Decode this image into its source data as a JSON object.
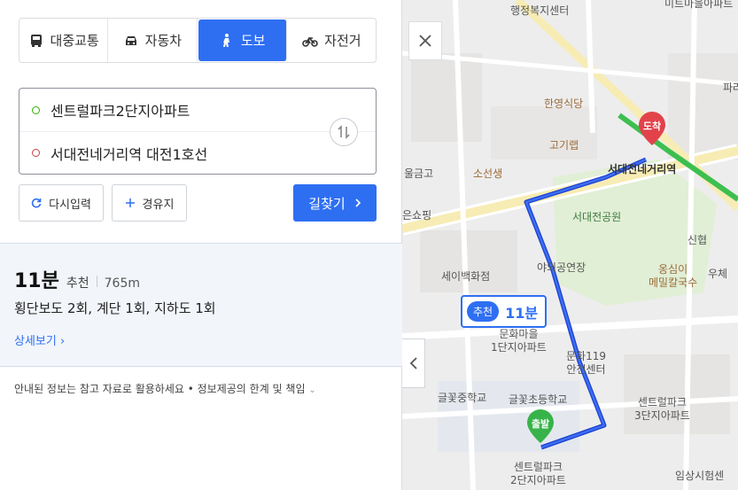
{
  "modes": [
    {
      "label": "대중교통",
      "icon": "bus-icon"
    },
    {
      "label": "자동차",
      "icon": "car-icon"
    },
    {
      "label": "도보",
      "icon": "walk-icon",
      "active": true
    },
    {
      "label": "자전거",
      "icon": "bicycle-icon"
    }
  ],
  "route": {
    "start": "센트럴파크2단지아파트",
    "end": "서대전네거리역 대전1호선"
  },
  "buttons": {
    "reset": "다시입력",
    "waypoint": "경유지",
    "search": "길찾기"
  },
  "result": {
    "time": "11분",
    "tag": "추천",
    "distance": "765m",
    "detail": "횡단보도 2회, 계단 1회, 지하도 1회",
    "more": "상세보기"
  },
  "notice": {
    "text": "안내된 정보는 참고 자료로 활용하세요",
    "link": "정보제공의 한계 및 책임"
  },
  "map": {
    "badge_tag": "추천",
    "badge_time": "11분",
    "pin_end": "도착",
    "pin_start": "출발",
    "labels": {
      "welfare": "행정복지센터",
      "mart": "미트마을아파트",
      "hanyang": "한영식당",
      "gogi": "고기랩",
      "station": "서대전네거리역",
      "bank": "울금고",
      "sosunsaeng": "소선생",
      "park": "서대전공원",
      "shopping": "은쇼핑",
      "outdoor": "야외공연장",
      "sinhan": "신협",
      "ongsim1": "옹심이",
      "ongsim2": "메밀칼국수",
      "uche": "우체",
      "sei": "세이백화점",
      "munhwa1": "문화마을",
      "munhwa2": "1단지아파트",
      "fire1": "문화119",
      "fire2": "안전센터",
      "middle": "글꽃중학교",
      "elem": "글꽃초등학교",
      "central3a": "센트럴파크",
      "central3b": "3단지아파트",
      "central2a": "센트럴파크",
      "central2b": "2단지아파트",
      "imsang": "임상시험센",
      "para": "파라"
    }
  }
}
